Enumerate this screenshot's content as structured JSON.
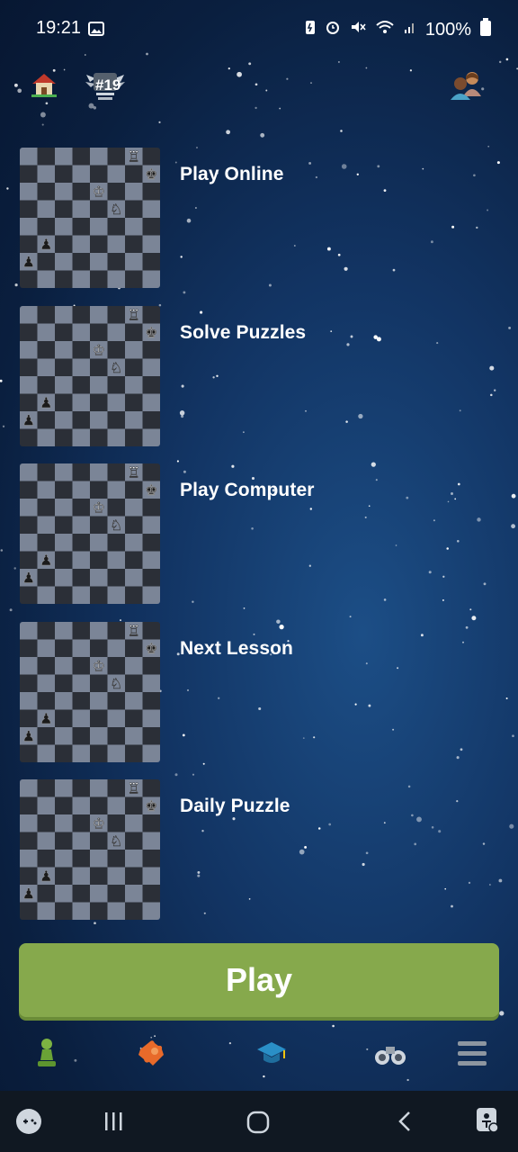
{
  "status_bar": {
    "time": "19:21",
    "battery": "100%",
    "icons": [
      "image-icon",
      "battery-saver-icon",
      "alarm-icon",
      "mute-icon",
      "wifi-icon",
      "signal-icon",
      "battery-icon"
    ]
  },
  "top_bar": {
    "home_icon": "home-icon",
    "rank_badge": "#19",
    "friends_icon": "friends-icon"
  },
  "menu": {
    "items": [
      {
        "label": "Play Online"
      },
      {
        "label": "Solve Puzzles"
      },
      {
        "label": "Play Computer"
      },
      {
        "label": "Next Lesson"
      },
      {
        "label": "Daily Puzzle"
      }
    ]
  },
  "play_button": {
    "label": "Play"
  },
  "bottom_nav": {
    "items": [
      {
        "icon": "pawn-icon"
      },
      {
        "icon": "puzzle-icon"
      },
      {
        "icon": "graduation-cap-icon"
      },
      {
        "icon": "binoculars-icon"
      },
      {
        "icon": "hamburger-menu-icon"
      }
    ]
  },
  "system_nav": {
    "items": [
      "game-launcher-icon",
      "recent-apps-icon",
      "home-circle-icon",
      "back-icon",
      "accessibility-icon"
    ]
  },
  "colors": {
    "play_green": "#86a94c",
    "board_dark": "#2b2f37",
    "board_light": "#7b8597"
  }
}
